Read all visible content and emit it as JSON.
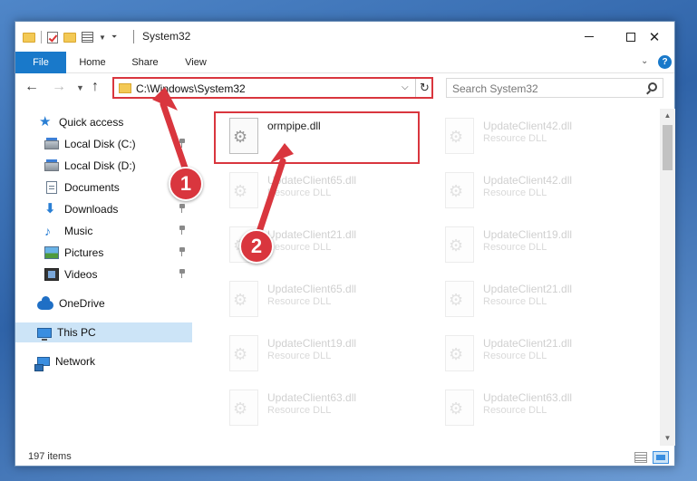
{
  "window": {
    "title": "System32"
  },
  "ribbon": {
    "tabs": [
      "File",
      "Home",
      "Share",
      "View"
    ],
    "help_label": "?"
  },
  "address_bar": {
    "path": "C:\\Windows\\System32"
  },
  "search": {
    "placeholder": "Search System32"
  },
  "sidebar": {
    "items": [
      {
        "label": "Quick access",
        "icon": "star-icon",
        "pinned": false,
        "selected": false
      },
      {
        "label": "Local Disk (C:)",
        "icon": "drive-icon",
        "pinned": true,
        "selected": false
      },
      {
        "label": "Local Disk (D:)",
        "icon": "drive-icon",
        "pinned": false,
        "selected": false
      },
      {
        "label": "Documents",
        "icon": "documents-icon",
        "pinned": true,
        "selected": false
      },
      {
        "label": "Downloads",
        "icon": "downloads-icon",
        "pinned": true,
        "selected": false
      },
      {
        "label": "Music",
        "icon": "music-icon",
        "pinned": true,
        "selected": false
      },
      {
        "label": "Pictures",
        "icon": "pictures-icon",
        "pinned": true,
        "selected": false
      },
      {
        "label": "Videos",
        "icon": "videos-icon",
        "pinned": true,
        "selected": false
      },
      {
        "label": "OneDrive",
        "icon": "onedrive-icon",
        "pinned": false,
        "selected": false
      },
      {
        "label": "This PC",
        "icon": "this-pc-icon",
        "pinned": false,
        "selected": true
      },
      {
        "label": "Network",
        "icon": "network-icon",
        "pinned": false,
        "selected": false
      }
    ]
  },
  "files": {
    "left": [
      {
        "name": "ormpipe.dll",
        "desc": "",
        "faded": false
      },
      {
        "name": "UpdateClient65.dll",
        "desc": "Resource DLL",
        "faded": true
      },
      {
        "name": "UpdateClient21.dll",
        "desc": "Resource DLL",
        "faded": true
      },
      {
        "name": "UpdateClient65.dll",
        "desc": "Resource DLL",
        "faded": true
      },
      {
        "name": "UpdateClient19.dll",
        "desc": "Resource DLL",
        "faded": true
      },
      {
        "name": "UpdateClient63.dll",
        "desc": "Resource DLL",
        "faded": true
      }
    ],
    "right": [
      {
        "name": "UpdateClient42.dll",
        "desc": "Resource DLL",
        "faded": true
      },
      {
        "name": "UpdateClient42.dll",
        "desc": "Resource DLL",
        "faded": true
      },
      {
        "name": "UpdateClient19.dll",
        "desc": "Resource DLL",
        "faded": true
      },
      {
        "name": "UpdateClient21.dll",
        "desc": "Resource DLL",
        "faded": true
      },
      {
        "name": "UpdateClient21.dll",
        "desc": "Resource DLL",
        "faded": true
      },
      {
        "name": "UpdateClient63.dll",
        "desc": "Resource DLL",
        "faded": true
      }
    ]
  },
  "status": {
    "item_count": "197 items"
  },
  "annotations": {
    "callout_1": "1",
    "callout_2": "2",
    "color": "#d9363e"
  }
}
